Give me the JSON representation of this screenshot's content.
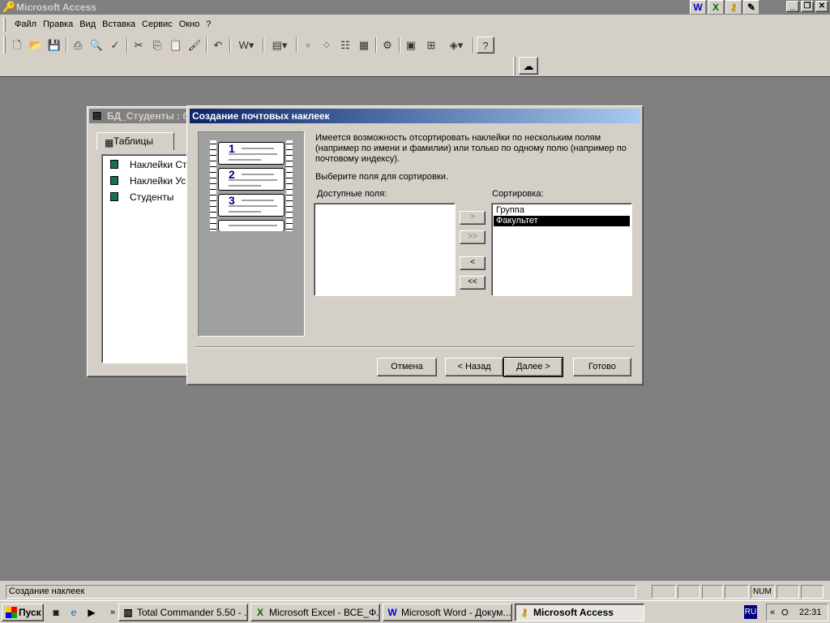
{
  "app": {
    "title": "Microsoft Access"
  },
  "office_icons": [
    "W",
    "X",
    "key",
    "note"
  ],
  "menu": [
    "Файл",
    "Правка",
    "Вид",
    "Вставка",
    "Сервис",
    "Окно",
    "?"
  ],
  "db_window": {
    "title": "БД_Студенты : б",
    "tab_label": "Таблицы",
    "items": [
      "Наклейки Сту",
      "Наклейки Усп",
      "Студенты"
    ]
  },
  "dialog": {
    "title": "Создание почтовых наклеек",
    "intro": "Имеется возможность отсортировать наклейки по нескольким полям (например по имени и фамилии) или только по одному полю (например по почтовому индексу).",
    "instruction": "Выберите поля для сортировки.",
    "available_label": "Доступные поля:",
    "sort_label": "Сортировка:",
    "sort_items": [
      "Группа",
      "Факультет"
    ],
    "illustration_numbers": [
      "1",
      "2",
      "3"
    ],
    "move_buttons": [
      ">",
      ">>",
      "<",
      "<<"
    ],
    "buttons": {
      "cancel": "Отмена",
      "back": "< Назад",
      "next": "Далее >",
      "finish": "Готово"
    }
  },
  "status": {
    "text": "Создание наклеек",
    "num": "NUM"
  },
  "taskbar": {
    "start": "Пуск",
    "tasks": [
      "Total Commander 5.50 - ...",
      "Microsoft Excel - ВСЕ_Ф...",
      "Microsoft Word - Докум...",
      "Microsoft Access"
    ],
    "lang": "RU",
    "time": "22:31"
  }
}
